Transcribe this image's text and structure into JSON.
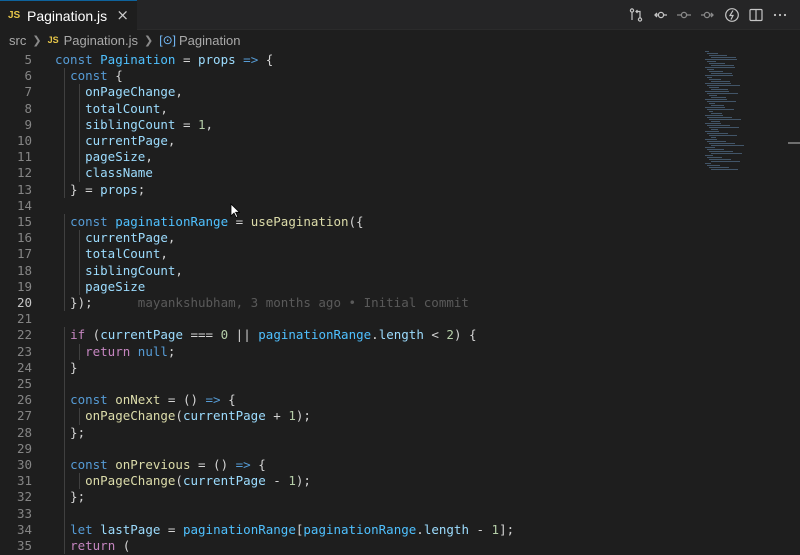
{
  "tab": {
    "badge": "JS",
    "title": "Pagination.js",
    "close": "×"
  },
  "breadcrumb": {
    "folder": "src",
    "file_badge": "JS",
    "file": "Pagination.js",
    "symbol_icon": "[⊙]",
    "symbol": "Pagination"
  },
  "actions": [
    "source-control-compare-icon",
    "git-commit-previous-icon",
    "git-commit-icon",
    "git-commit-next-icon",
    "go-live-icon",
    "split-editor-icon",
    "more-actions-icon"
  ],
  "editor": {
    "active_line": 20,
    "blame": "mayankshubham, 3 months ago • Initial commit",
    "lines": [
      {
        "n": "5",
        "t": [
          [
            "kw",
            "const "
          ],
          [
            "cst",
            "Pagination"
          ],
          [
            "op",
            " = "
          ],
          [
            "var",
            "props"
          ],
          [
            "op",
            " "
          ],
          [
            "kw",
            "=>"
          ],
          [
            "op",
            " {"
          ]
        ]
      },
      {
        "n": "6",
        "t": [
          [
            "op",
            "  "
          ],
          [
            "kw",
            "const"
          ],
          [
            "op",
            " {"
          ]
        ]
      },
      {
        "n": "7",
        "t": [
          [
            "op",
            "    "
          ],
          [
            "var",
            "onPageChange"
          ],
          [
            "op",
            ","
          ]
        ]
      },
      {
        "n": "8",
        "t": [
          [
            "op",
            "    "
          ],
          [
            "var",
            "totalCount"
          ],
          [
            "op",
            ","
          ]
        ]
      },
      {
        "n": "9",
        "t": [
          [
            "op",
            "    "
          ],
          [
            "var",
            "siblingCount"
          ],
          [
            "op",
            " = "
          ],
          [
            "num",
            "1"
          ],
          [
            "op",
            ","
          ]
        ]
      },
      {
        "n": "10",
        "t": [
          [
            "op",
            "    "
          ],
          [
            "var",
            "currentPage"
          ],
          [
            "op",
            ","
          ]
        ]
      },
      {
        "n": "11",
        "t": [
          [
            "op",
            "    "
          ],
          [
            "var",
            "pageSize"
          ],
          [
            "op",
            ","
          ]
        ]
      },
      {
        "n": "12",
        "t": [
          [
            "op",
            "    "
          ],
          [
            "var",
            "className"
          ]
        ]
      },
      {
        "n": "13",
        "t": [
          [
            "op",
            "  } = "
          ],
          [
            "var",
            "props"
          ],
          [
            "op",
            ";"
          ]
        ]
      },
      {
        "n": "14",
        "t": []
      },
      {
        "n": "15",
        "t": [
          [
            "op",
            "  "
          ],
          [
            "kw",
            "const "
          ],
          [
            "cst",
            "paginationRange"
          ],
          [
            "op",
            " = "
          ],
          [
            "fn",
            "usePagination"
          ],
          [
            "op",
            "({"
          ]
        ]
      },
      {
        "n": "16",
        "t": [
          [
            "op",
            "    "
          ],
          [
            "var",
            "currentPage"
          ],
          [
            "op",
            ","
          ]
        ]
      },
      {
        "n": "17",
        "t": [
          [
            "op",
            "    "
          ],
          [
            "var",
            "totalCount"
          ],
          [
            "op",
            ","
          ]
        ]
      },
      {
        "n": "18",
        "t": [
          [
            "op",
            "    "
          ],
          [
            "var",
            "siblingCount"
          ],
          [
            "op",
            ","
          ]
        ]
      },
      {
        "n": "19",
        "t": [
          [
            "op",
            "    "
          ],
          [
            "var",
            "pageSize"
          ]
        ]
      },
      {
        "n": "20",
        "t": [
          [
            "op",
            "  });"
          ]
        ],
        "blame": true
      },
      {
        "n": "21",
        "t": []
      },
      {
        "n": "22",
        "t": [
          [
            "op",
            "  "
          ],
          [
            "kw2",
            "if"
          ],
          [
            "op",
            " ("
          ],
          [
            "var",
            "currentPage"
          ],
          [
            "op",
            " === "
          ],
          [
            "num",
            "0"
          ],
          [
            "op",
            " || "
          ],
          [
            "cst",
            "paginationRange"
          ],
          [
            "op",
            "."
          ],
          [
            "var",
            "length"
          ],
          [
            "op",
            " < "
          ],
          [
            "num",
            "2"
          ],
          [
            "op",
            ") {"
          ]
        ]
      },
      {
        "n": "23",
        "t": [
          [
            "op",
            "    "
          ],
          [
            "kw2",
            "return "
          ],
          [
            "kw",
            "null"
          ],
          [
            "op",
            ";"
          ]
        ]
      },
      {
        "n": "24",
        "t": [
          [
            "op",
            "  }"
          ]
        ]
      },
      {
        "n": "25",
        "t": []
      },
      {
        "n": "26",
        "t": [
          [
            "op",
            "  "
          ],
          [
            "kw",
            "const "
          ],
          [
            "fn",
            "onNext"
          ],
          [
            "op",
            " = () "
          ],
          [
            "kw",
            "=>"
          ],
          [
            "op",
            " {"
          ]
        ]
      },
      {
        "n": "27",
        "t": [
          [
            "op",
            "    "
          ],
          [
            "fn",
            "onPageChange"
          ],
          [
            "op",
            "("
          ],
          [
            "var",
            "currentPage"
          ],
          [
            "op",
            " + "
          ],
          [
            "num",
            "1"
          ],
          [
            "op",
            ");"
          ]
        ]
      },
      {
        "n": "28",
        "t": [
          [
            "op",
            "  };"
          ]
        ]
      },
      {
        "n": "29",
        "t": []
      },
      {
        "n": "30",
        "t": [
          [
            "op",
            "  "
          ],
          [
            "kw",
            "const "
          ],
          [
            "fn",
            "onPrevious"
          ],
          [
            "op",
            " = () "
          ],
          [
            "kw",
            "=>"
          ],
          [
            "op",
            " {"
          ]
        ]
      },
      {
        "n": "31",
        "t": [
          [
            "op",
            "    "
          ],
          [
            "fn",
            "onPageChange"
          ],
          [
            "op",
            "("
          ],
          [
            "var",
            "currentPage"
          ],
          [
            "op",
            " - "
          ],
          [
            "num",
            "1"
          ],
          [
            "op",
            ");"
          ]
        ]
      },
      {
        "n": "32",
        "t": [
          [
            "op",
            "  };"
          ]
        ]
      },
      {
        "n": "33",
        "t": []
      },
      {
        "n": "34",
        "t": [
          [
            "op",
            "  "
          ],
          [
            "kw",
            "let "
          ],
          [
            "var",
            "lastPage"
          ],
          [
            "op",
            " = "
          ],
          [
            "cst",
            "paginationRange"
          ],
          [
            "op",
            "["
          ],
          [
            "cst",
            "paginationRange"
          ],
          [
            "op",
            "."
          ],
          [
            "var",
            "length"
          ],
          [
            "op",
            " - "
          ],
          [
            "num",
            "1"
          ],
          [
            "op",
            "];"
          ]
        ]
      },
      {
        "n": "35",
        "t": [
          [
            "op",
            "  "
          ],
          [
            "kw2",
            "return"
          ],
          [
            "op",
            " ("
          ]
        ]
      }
    ]
  }
}
